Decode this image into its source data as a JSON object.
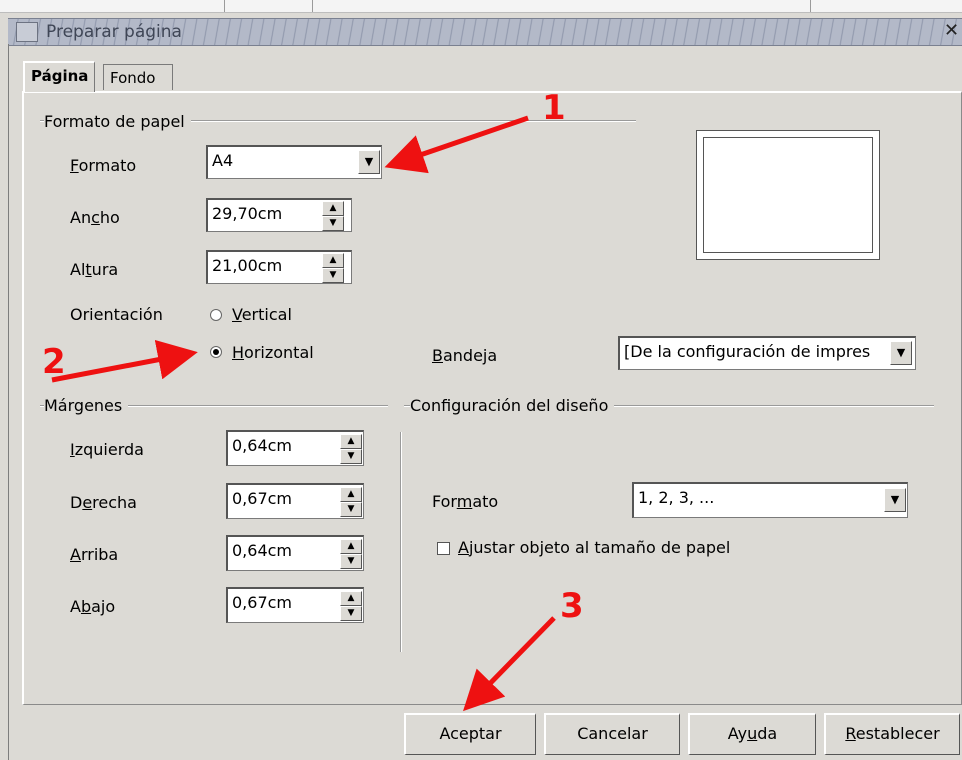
{
  "window": {
    "title": "Preparar página",
    "close_glyph": "✕"
  },
  "tabs": [
    {
      "label": "Página",
      "active": true
    },
    {
      "label": "Fondo",
      "active": false
    }
  ],
  "paper_format": {
    "group_title": "Formato de papel",
    "format": {
      "label_pre": "",
      "label_u": "F",
      "label_post": "ormato",
      "value": "A4"
    },
    "width": {
      "label_pre": "An",
      "label_u": "c",
      "label_post": "ho",
      "value": "29,70cm"
    },
    "height": {
      "label_pre": "Al",
      "label_u": "t",
      "label_post": "ura",
      "value": "21,00cm"
    },
    "orientation": {
      "label": "Orientación",
      "vertical": {
        "label_pre": "",
        "label_u": "V",
        "label_post": "ertical",
        "selected": false
      },
      "horizontal": {
        "label_pre": "",
        "label_u": "H",
        "label_post": "orizontal",
        "selected": true
      }
    },
    "tray": {
      "label_pre": "",
      "label_u": "B",
      "label_post": "andeja",
      "value": "[De la configuración de impres"
    }
  },
  "margins": {
    "group_title": "Márgenes",
    "left": {
      "label_pre": "",
      "label_u": "I",
      "label_post": "zquierda",
      "value": "0,64cm"
    },
    "right": {
      "label_pre": "D",
      "label_u": "e",
      "label_post": "recha",
      "value": "0,67cm"
    },
    "top": {
      "label_pre": "",
      "label_u": "A",
      "label_post": "rriba",
      "value": "0,64cm"
    },
    "bottom": {
      "label_pre": "A",
      "label_u": "b",
      "label_post": "ajo",
      "value": "0,67cm"
    }
  },
  "layout": {
    "group_title": "Configuración del diseño",
    "format": {
      "label_pre": "For",
      "label_u": "m",
      "label_post": "ato",
      "value": "1, 2, 3, ..."
    },
    "fit": {
      "label_pre": "",
      "label_u": "A",
      "label_post": "justar objeto al tamaño de papel",
      "checked": false
    }
  },
  "buttons": {
    "ok": {
      "label_pre": "Aceptar",
      "label_u": "",
      "label_post": ""
    },
    "cancel": {
      "label_pre": "Cancelar",
      "label_u": "",
      "label_post": ""
    },
    "help": {
      "label_pre": "Ay",
      "label_u": "u",
      "label_post": "da"
    },
    "reset": {
      "label_pre": "",
      "label_u": "R",
      "label_post": "establecer"
    }
  },
  "annotations": {
    "n1": "1",
    "n2": "2",
    "n3": "3",
    "color": "#ee1111"
  },
  "icons": {
    "dropdown": "▼",
    "spin_up": "▲",
    "spin_down": "▼"
  }
}
